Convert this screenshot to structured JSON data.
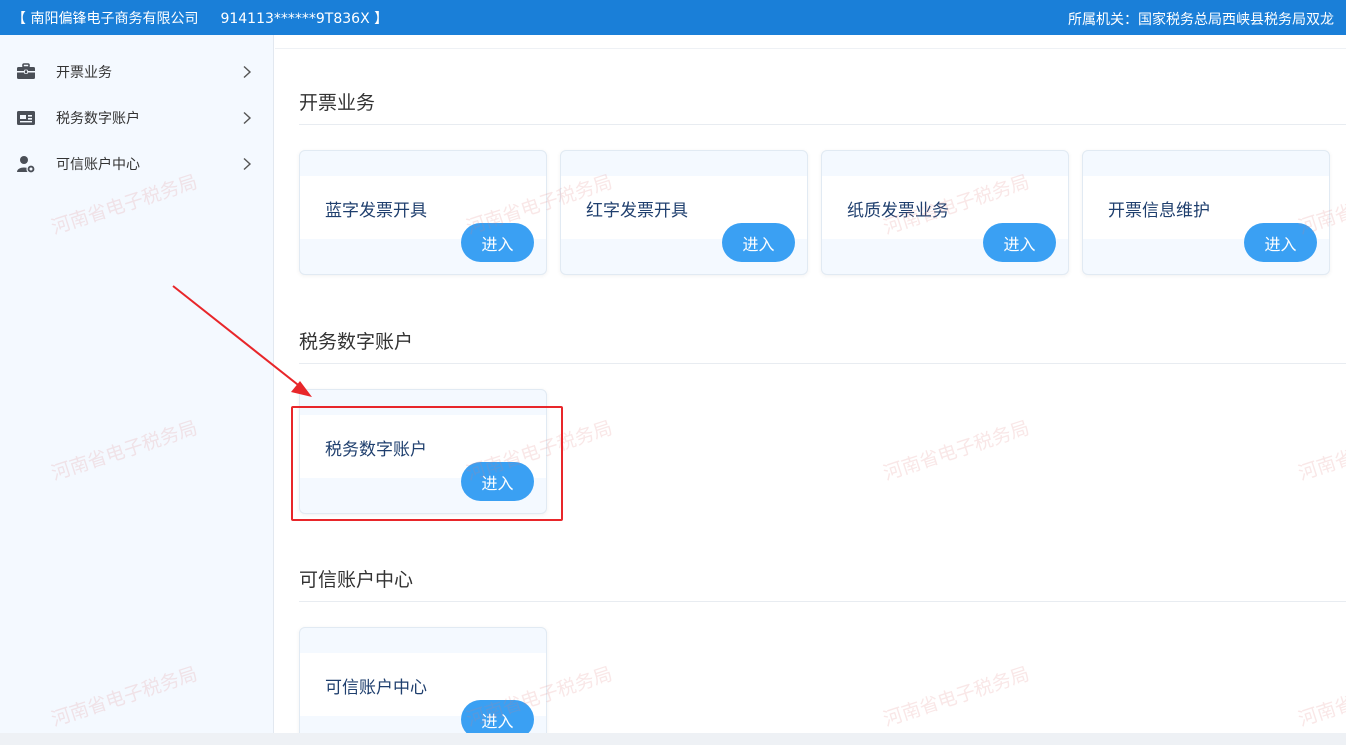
{
  "header": {
    "company": "【 南阳偏锋电子商务有限公司",
    "tax_id": "914113******9T836X 】",
    "agency": "所属机关：国家税务总局西峡县税务局双龙"
  },
  "sidebar": {
    "items": [
      {
        "label": "开票业务",
        "icon": "briefcase-icon"
      },
      {
        "label": "税务数字账户",
        "icon": "account-card-icon"
      },
      {
        "label": "可信账户中心",
        "icon": "user-shield-icon"
      }
    ]
  },
  "sections": [
    {
      "title": "开票业务",
      "cards": [
        {
          "title": "蓝字发票开具",
          "button": "进入"
        },
        {
          "title": "红字发票开具",
          "button": "进入"
        },
        {
          "title": "纸质发票业务",
          "button": "进入"
        },
        {
          "title": "开票信息维护",
          "button": "进入"
        }
      ]
    },
    {
      "title": "税务数字账户",
      "cards": [
        {
          "title": "税务数字账户",
          "button": "进入"
        }
      ]
    },
    {
      "title": "可信账户中心",
      "cards": [
        {
          "title": "可信账户中心",
          "button": "进入"
        }
      ]
    }
  ],
  "watermark": "河南省电子税务局",
  "colors": {
    "header_bg": "#1a7fd8",
    "button_bg": "#3aa0f3",
    "highlight": "#e8262a",
    "sidebar_bg": "#f4f9ff"
  }
}
